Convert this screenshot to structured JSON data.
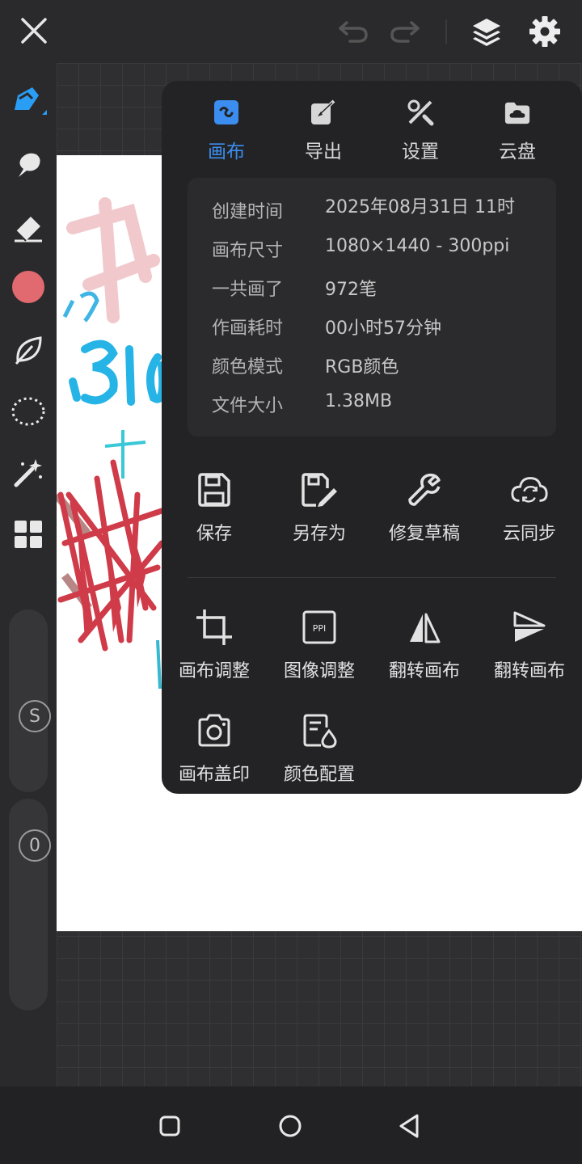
{
  "colors": {
    "accent": "#3b8ef0",
    "brush_color": "#e06a6f",
    "panel_bg": "#232325"
  },
  "top_bar": {
    "close_icon": "close-icon",
    "undo_icon": "undo-icon",
    "redo_icon": "redo-icon",
    "layers_icon": "layers-icon",
    "settings_icon": "gear-icon"
  },
  "sidebar": {
    "tools": [
      "brush-icon",
      "smudge-icon",
      "eraser-icon",
      "color-swatch",
      "leaf-icon",
      "lasso-icon",
      "magic-wand-icon",
      "grid-icon"
    ],
    "size_slider": {
      "label": "S"
    },
    "opacity_slider": {
      "label": "0"
    }
  },
  "panel": {
    "tabs": [
      {
        "label": "画布",
        "icon": "canvas-icon",
        "active": true
      },
      {
        "label": "导出",
        "icon": "export-icon",
        "active": false
      },
      {
        "label": "设置",
        "icon": "tools-icon",
        "active": false
      },
      {
        "label": "云盘",
        "icon": "cloud-drive-icon",
        "active": false
      }
    ],
    "info": [
      {
        "key": "创建时间",
        "value": "2025年08月31日 11时"
      },
      {
        "key": "画布尺寸",
        "value": "1080×1440 - 300ppi"
      },
      {
        "key": "一共画了",
        "value": "972笔"
      },
      {
        "key": "作画耗时",
        "value": "00小时57分钟"
      },
      {
        "key": "颜色模式",
        "value": "RGB颜色"
      },
      {
        "key": "文件大小",
        "value": "1.38MB"
      }
    ],
    "actions_row1": [
      {
        "label": "保存",
        "icon": "save-icon"
      },
      {
        "label": "另存为",
        "icon": "save-as-icon"
      },
      {
        "label": "修复草稿",
        "icon": "wrench-icon"
      },
      {
        "label": "云同步",
        "icon": "cloud-sync-icon"
      }
    ],
    "actions_row2": [
      {
        "label": "画布调整",
        "icon": "crop-icon"
      },
      {
        "label": "图像调整",
        "icon": "ppi-icon"
      },
      {
        "label": "翻转画布",
        "icon": "flip-horizontal-icon"
      },
      {
        "label": "翻转画布",
        "icon": "flip-vertical-icon"
      }
    ],
    "actions_row3": [
      {
        "label": "画布盖印",
        "icon": "camera-icon"
      },
      {
        "label": "颜色配置",
        "icon": "color-config-icon"
      }
    ]
  },
  "nav_bar": {
    "recent": "square-icon",
    "home": "circle-icon",
    "back": "triangle-back-icon"
  }
}
